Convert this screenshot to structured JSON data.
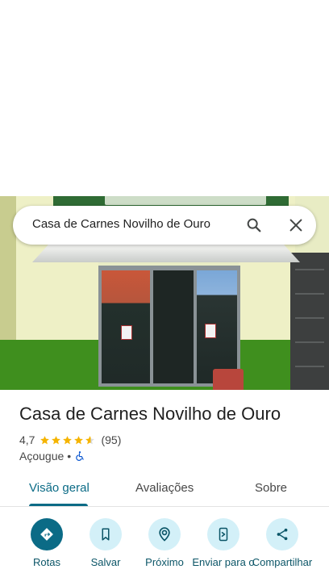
{
  "search": {
    "query": "Casa de Carnes Novilho de Ouro"
  },
  "place": {
    "name": "Casa de Carnes Novilho de Ouro",
    "rating": "4,7",
    "rating_value": 4.7,
    "review_count": "(95)",
    "category": "Açougue",
    "separator": "•",
    "accessibility_icon": "wheelchair-icon"
  },
  "tabs": [
    {
      "label": "Visão geral",
      "active": true
    },
    {
      "label": "Avaliações",
      "active": false
    },
    {
      "label": "Sobre",
      "active": false
    }
  ],
  "actions": [
    {
      "label": "Rotas",
      "icon": "directions-icon",
      "primary": true
    },
    {
      "label": "Salvar",
      "icon": "bookmark-icon",
      "primary": false
    },
    {
      "label": "Próximo",
      "icon": "nearby-icon",
      "primary": false
    },
    {
      "label": "Enviar para o",
      "icon": "send-to-phone-icon",
      "primary": false
    },
    {
      "label": "Compartilhar",
      "icon": "share-icon",
      "primary": false
    }
  ],
  "colors": {
    "accent": "#0b6b86",
    "accent_light": "#d3f0f8",
    "star": "#f5b400",
    "text_primary": "#1f1f1f",
    "text_secondary": "#474747"
  }
}
